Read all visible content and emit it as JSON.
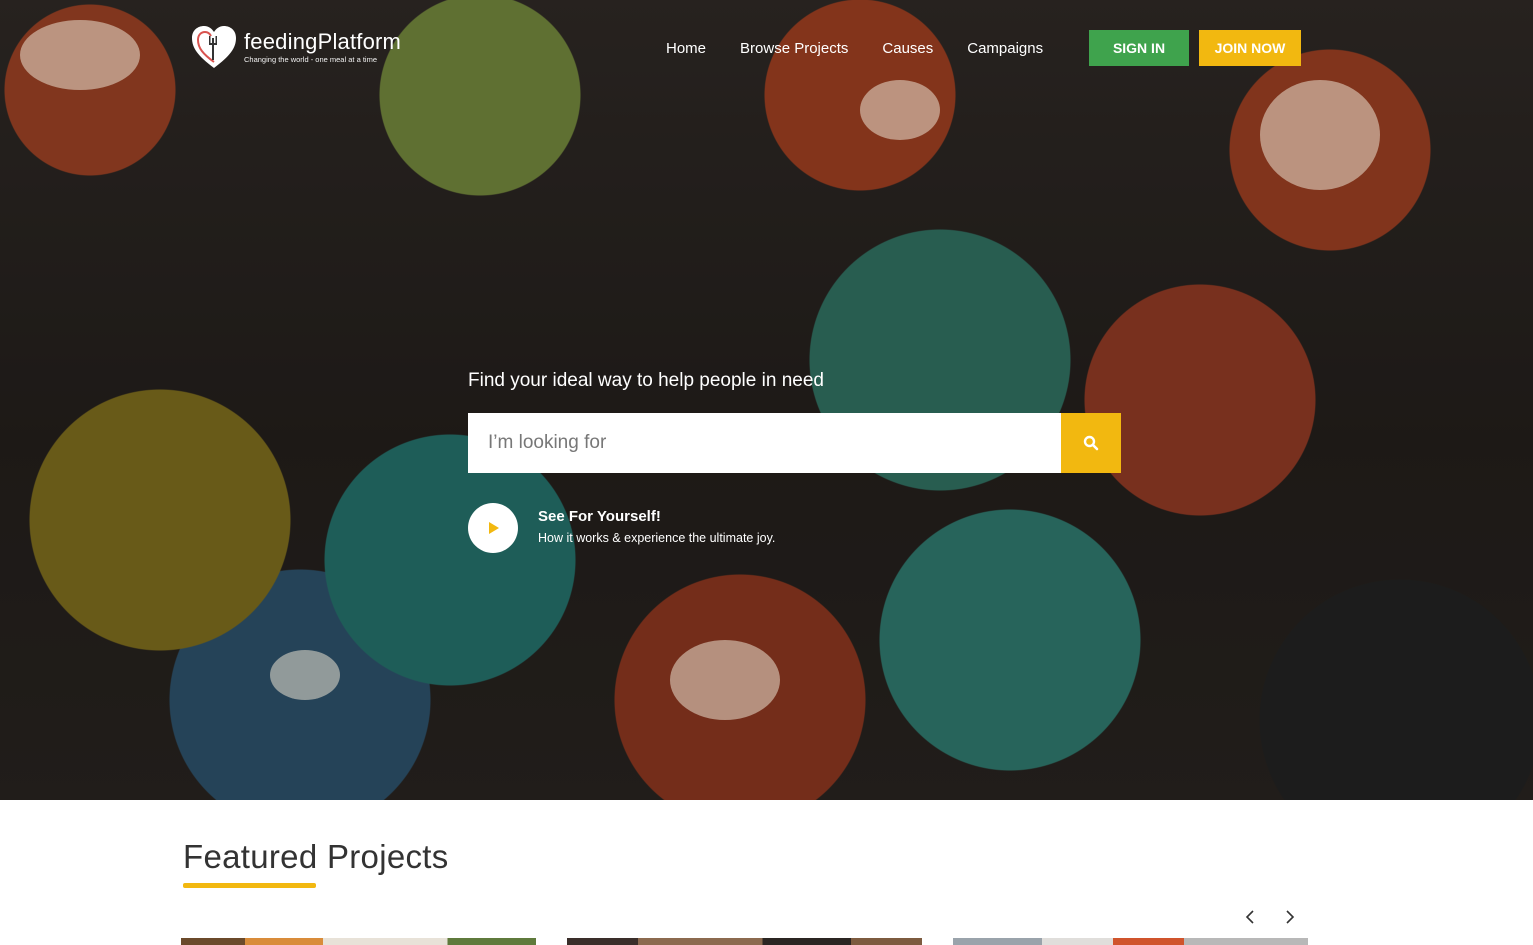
{
  "brand": {
    "name": "feedingPlatform",
    "tagline": "Changing the world - one meal at a time"
  },
  "nav": {
    "items": [
      {
        "label": "Home"
      },
      {
        "label": "Browse Projects"
      },
      {
        "label": "Causes"
      },
      {
        "label": "Campaigns"
      }
    ],
    "signin_label": "SIGN IN",
    "join_label": "JOIN NOW"
  },
  "hero": {
    "tagline": "Find your ideal way to help people in need",
    "search_placeholder": "I’m looking for",
    "video_title": "See For Yourself!",
    "video_subtitle": "How it works & experience the ultimate joy."
  },
  "featured": {
    "title": "Featured Projects"
  },
  "colors": {
    "accent_yellow": "#f2b810",
    "signin_green": "#3fa34d"
  },
  "icons": {
    "logo": "heart-fork-icon",
    "search": "search-icon",
    "play": "play-icon",
    "prev": "chevron-left-icon",
    "next": "chevron-right-icon"
  }
}
